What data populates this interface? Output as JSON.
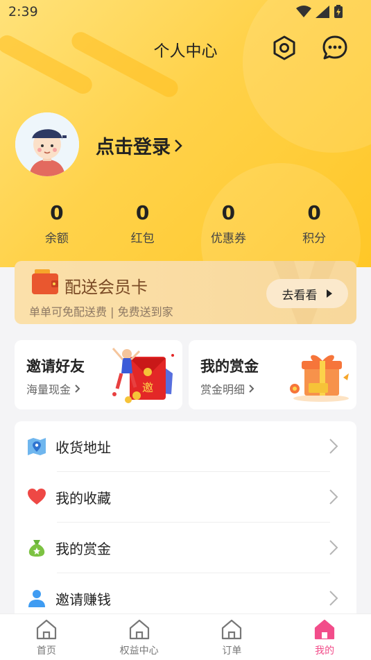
{
  "status_bar": {
    "time": "2:39"
  },
  "header": {
    "title": "个人中心"
  },
  "profile": {
    "login_text": "点击登录"
  },
  "stats": [
    {
      "value": "0",
      "label": "余额"
    },
    {
      "value": "0",
      "label": "红包"
    },
    {
      "value": "0",
      "label": "优惠券"
    },
    {
      "value": "0",
      "label": "积分"
    }
  ],
  "vip_card": {
    "title": "配送会员卡",
    "subtitle": "单单可免配送费 | 免费送到家",
    "button_label": "去看看"
  },
  "cards": {
    "invite": {
      "title": "邀请好友",
      "subtitle": "海量现金",
      "badge": "邀"
    },
    "bounty": {
      "title": "我的赏金",
      "subtitle": "赏金明细"
    }
  },
  "menu": [
    {
      "label": "收货地址",
      "icon": "map-pin-icon"
    },
    {
      "label": "我的收藏",
      "icon": "heart-icon"
    },
    {
      "label": "我的赏金",
      "icon": "money-bag-icon"
    },
    {
      "label": "邀请赚钱",
      "icon": "user-icon"
    }
  ],
  "tabbar": [
    {
      "label": "首页",
      "icon": "home-icon"
    },
    {
      "label": "权益中心",
      "icon": "home-icon"
    },
    {
      "label": "订单",
      "icon": "home-icon"
    },
    {
      "label": "我的",
      "icon": "home-icon"
    }
  ],
  "colors": {
    "header_yellow": "#ffd24a",
    "active_pink": "#f24d8a",
    "vip_brown": "#7a4a25"
  }
}
